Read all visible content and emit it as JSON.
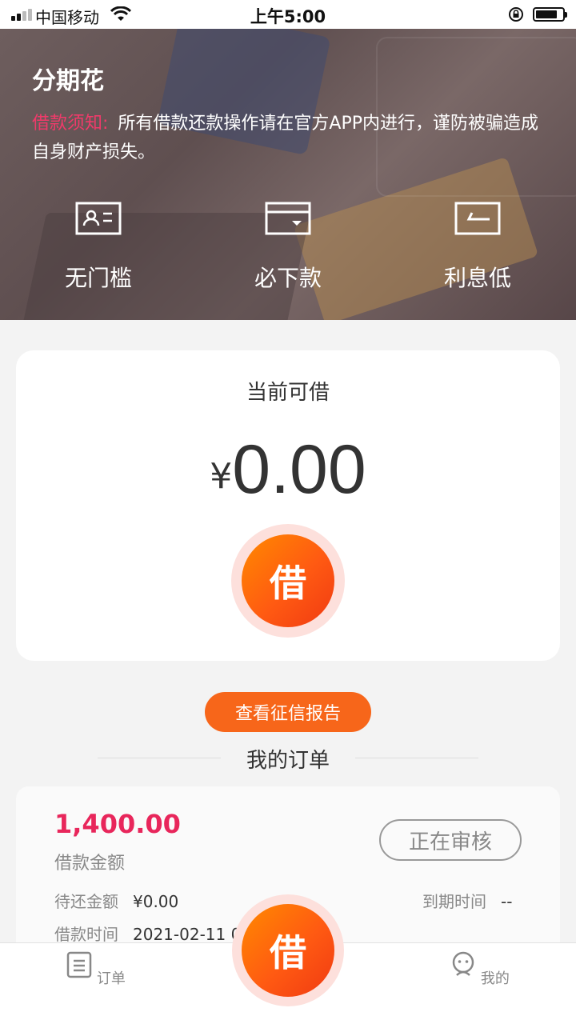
{
  "status_bar": {
    "carrier": "中国移动",
    "time": "上午5:00"
  },
  "hero": {
    "title": "分期花",
    "notice_label": "借款须知:",
    "notice_text": "所有借款还款操作请在官方APP内进行，谨防被骗造成自身财产损失。",
    "features": [
      {
        "label": "无门槛",
        "icon": "id-card-icon"
      },
      {
        "label": "必下款",
        "icon": "card-icon"
      },
      {
        "label": "利息低",
        "icon": "rate-icon"
      }
    ]
  },
  "loan_card": {
    "title": "当前可借",
    "currency": "¥",
    "amount": "0.00",
    "borrow_label": "借"
  },
  "credit_report_button": "查看征信报告",
  "orders": {
    "heading": "我的订单",
    "amount": "1,400.00",
    "amount_label": "借款金额",
    "status": "正在审核",
    "due_amount_label": "待还金额",
    "due_amount": "¥0.00",
    "due_date_label": "到期时间",
    "due_date": "--",
    "loan_time_label": "借款时间",
    "loan_time": "2021-02-11 0"
  },
  "tab_bar": {
    "orders_label": "订单",
    "borrow_label": "借",
    "mine_label": "我的"
  },
  "colors": {
    "accent_orange": "#ff6a10",
    "notice_pink": "#f03a6a",
    "amount_red": "#e8265b"
  }
}
